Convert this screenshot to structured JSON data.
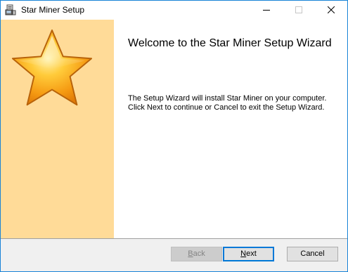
{
  "window": {
    "title": "Star Miner Setup",
    "app_icon": "installer-icon",
    "controls": {
      "minimize_icon": "minimize-icon",
      "maximize_icon": "maximize-icon",
      "close_icon": "close-icon"
    }
  },
  "side_panel": {
    "background_color": "#ffdb98",
    "graphic": "star-icon"
  },
  "content": {
    "heading": "Welcome to the Star Miner Setup Wizard",
    "description_line1": "The Setup Wizard will install Star Miner on your computer.",
    "description_line2": "Click Next to continue or Cancel to exit the Setup Wizard."
  },
  "footer": {
    "back": {
      "mnemonic": "B",
      "rest": "ack",
      "enabled": false
    },
    "next": {
      "mnemonic": "N",
      "rest": "ext",
      "default": true
    },
    "cancel": {
      "label": "Cancel"
    }
  },
  "colors": {
    "accent": "#0078d7",
    "window_border": "#1883d7"
  }
}
